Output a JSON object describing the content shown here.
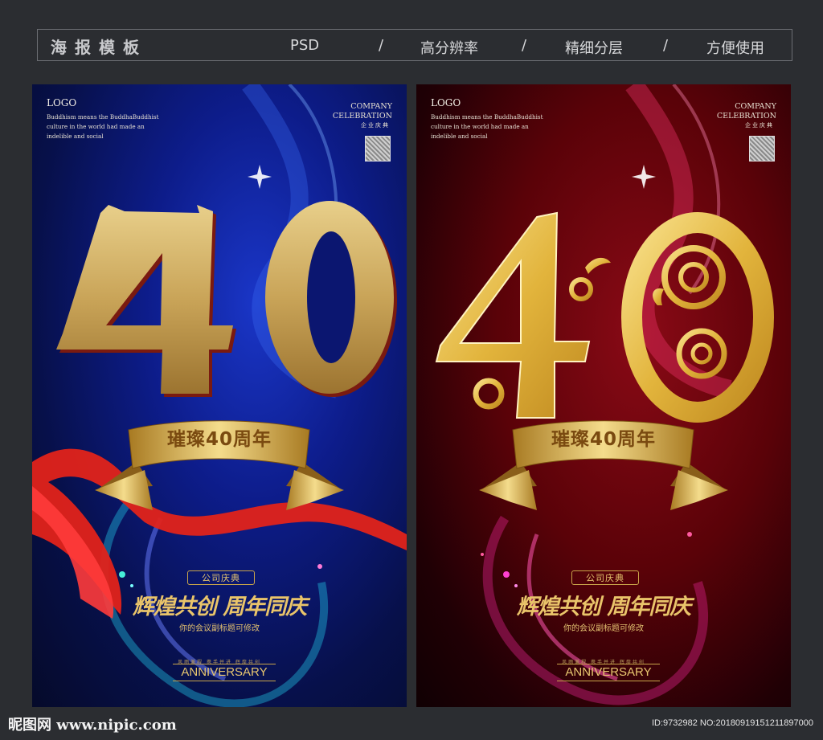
{
  "header": {
    "title": "海报模板",
    "items": [
      "PSD",
      "高分辨率",
      "精细分层",
      "方便使用"
    ],
    "separator": "/"
  },
  "posters": [
    {
      "logo": "LOGO",
      "small_text": "Buddhism means the BuddhaBuddhist culture in the world had made an indelible and social",
      "company_line1": "COMPANY",
      "company_line2": "CELEBRATION",
      "company_cn": "企业庆典",
      "number": "40",
      "ribbon": "璀璨40周年",
      "tag": "公司庆典",
      "slogan": "辉煌共创 周年同庆",
      "subtitle": "你的会议副标题可修改",
      "tiny_text": "风雨兼程 携手并进 辉煌共创",
      "anniversary": "ANNIVERSARY",
      "colors": {
        "bg": "#0d1c8a",
        "accent": "#d4a94b"
      }
    },
    {
      "logo": "LOGO",
      "small_text": "Buddhism means the BuddhaBuddhist culture in the world had made an indelible and social",
      "company_line1": "COMPANY",
      "company_line2": "CELEBRATION",
      "company_cn": "企业庆典",
      "number": "40",
      "ribbon": "璀璨40周年",
      "tag": "公司庆典",
      "slogan": "辉煌共创 周年同庆",
      "subtitle": "你的会议副标题可修改",
      "tiny_text": "风雨兼程 携手并进 辉煌共创",
      "anniversary": "ANNIVERSARY",
      "colors": {
        "bg": "#5a0208",
        "accent": "#e3b84a"
      }
    }
  ],
  "footer": {
    "logo": "昵图网 www.nipic.com",
    "id": "ID:9732982 NO:20180919151211897000"
  }
}
